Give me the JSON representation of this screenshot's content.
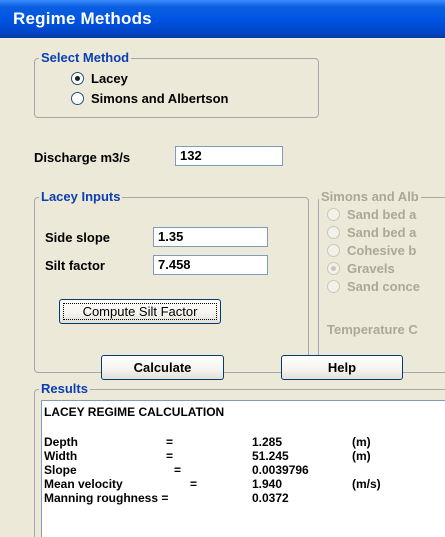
{
  "window": {
    "title": "Regime Methods"
  },
  "select_method": {
    "legend": "Select Method",
    "options": [
      {
        "label": "Lacey",
        "selected": true
      },
      {
        "label": "Simons and Albertson",
        "selected": false
      }
    ]
  },
  "discharge": {
    "label": "Discharge m3/s",
    "value": "132"
  },
  "lacey_inputs": {
    "legend": "Lacey Inputs",
    "side_slope": {
      "label": "Side slope",
      "value": "1.35"
    },
    "silt_factor": {
      "label": "Silt factor",
      "value": "7.458"
    },
    "compute_button": "Compute Silt Factor"
  },
  "simons_albertson": {
    "legend": "Simons and Alb",
    "options": [
      {
        "label": "Sand bed a",
        "selected": false
      },
      {
        "label": "Sand bed a",
        "selected": false
      },
      {
        "label": "Cohesive b",
        "selected": false
      },
      {
        "label": "Gravels",
        "selected": true
      },
      {
        "label": "Sand conce",
        "selected": false
      }
    ],
    "temperature_label": "Temperature C"
  },
  "buttons": {
    "calculate": "Calculate",
    "help": "Help"
  },
  "results": {
    "legend": "Results",
    "heading": "LACEY REGIME CALCULATION",
    "rows": [
      {
        "name": "Depth",
        "eq": "=",
        "value": "1.285",
        "unit": "(m)"
      },
      {
        "name": "Width",
        "eq": "=",
        "value": "51.245",
        "unit": "(m)"
      },
      {
        "name": "Slope",
        "eq": "=",
        "value": "0.0039796",
        "unit": ""
      },
      {
        "name": "Mean velocity",
        "eq": "=",
        "value": "1.940",
        "unit": "(m/s)"
      },
      {
        "name": "Manning roughness =",
        "eq": "",
        "value": "0.0372",
        "unit": ""
      }
    ]
  },
  "colors": {
    "title_bar": "#0054e3",
    "window_bg": "#ece9d8",
    "legend_text": "#0b3fb4",
    "disabled_text": "#aca899"
  }
}
